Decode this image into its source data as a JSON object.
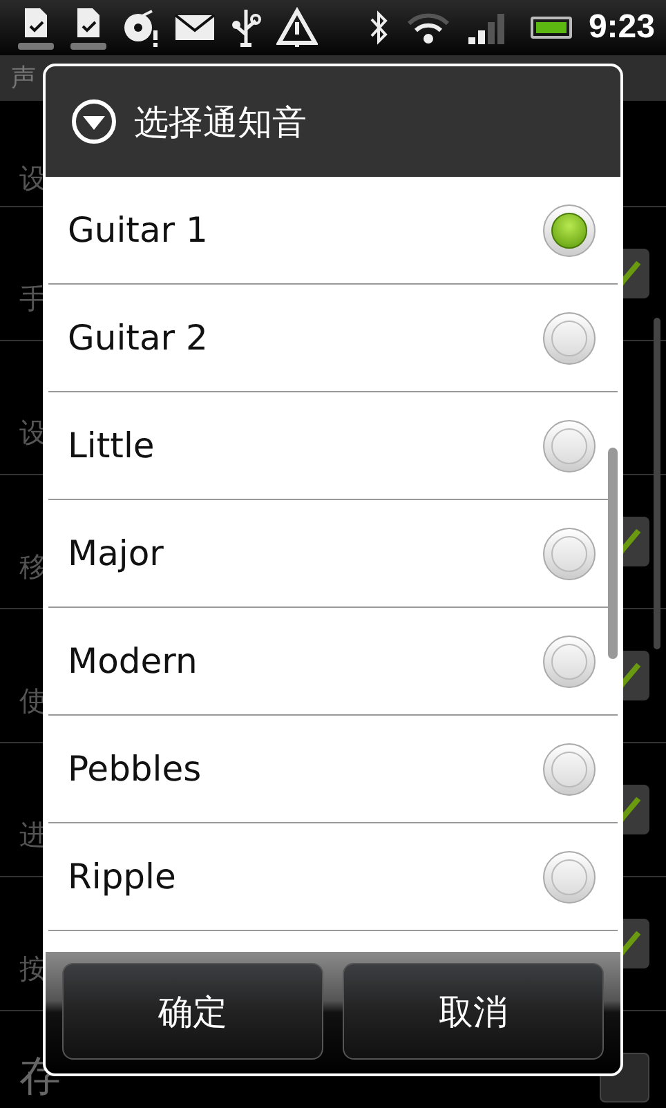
{
  "status_bar": {
    "time": "9:23"
  },
  "background": {
    "header": "声",
    "rows": [
      {
        "subtitle": "设"
      },
      {
        "subtitle": "手",
        "checked": true
      },
      {
        "subtitle": "设"
      },
      {
        "subtitle": "移",
        "checked": true
      },
      {
        "subtitle": "使",
        "checked": true
      },
      {
        "subtitle": "进",
        "checked": true
      },
      {
        "subtitle": "按",
        "checked": true
      },
      {
        "title": "存",
        "checked": false
      }
    ]
  },
  "dialog": {
    "title": "选择通知音",
    "options": [
      {
        "label": "Guitar 1",
        "selected": true
      },
      {
        "label": "Guitar 2",
        "selected": false
      },
      {
        "label": "Little",
        "selected": false
      },
      {
        "label": "Major",
        "selected": false
      },
      {
        "label": "Modern",
        "selected": false
      },
      {
        "label": "Pebbles",
        "selected": false
      },
      {
        "label": "Ripple",
        "selected": false
      }
    ],
    "buttons": [
      "确定",
      "取消"
    ]
  }
}
